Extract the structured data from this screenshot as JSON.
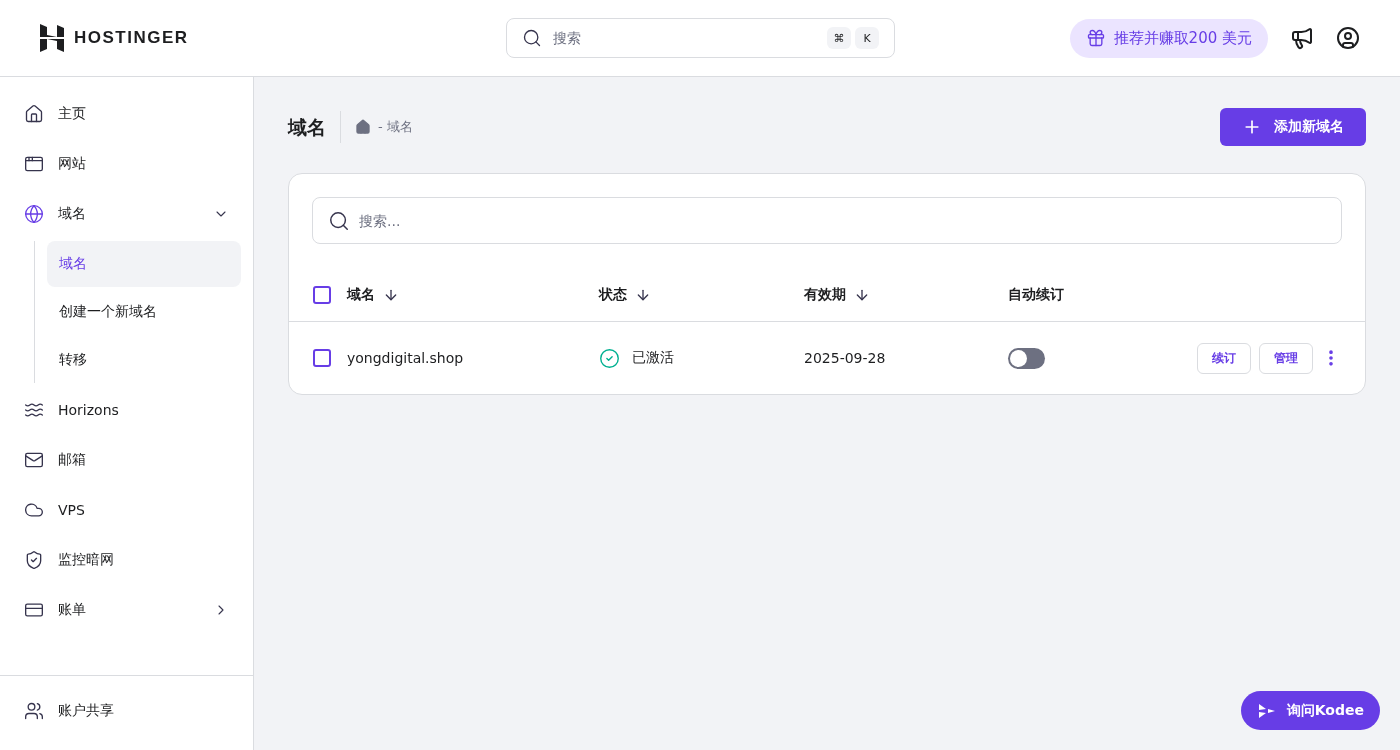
{
  "header": {
    "logo": "HOSTINGER",
    "search": {
      "placeholder": "搜索",
      "keys": [
        "⌘",
        "K"
      ]
    },
    "referral": "推荐并赚取200 美元"
  },
  "sidebar": {
    "items": [
      {
        "label": "主页",
        "selected": false
      },
      {
        "label": "网站",
        "selected": false
      },
      {
        "label": "域名",
        "selected": false,
        "expanded": true,
        "children": [
          {
            "label": "域名",
            "selected": true
          },
          {
            "label": "创建一个新域名",
            "selected": false
          },
          {
            "label": "转移",
            "selected": false
          }
        ]
      },
      {
        "label": "Horizons",
        "selected": false
      },
      {
        "label": "邮箱",
        "selected": false
      },
      {
        "label": "VPS",
        "selected": false
      },
      {
        "label": "监控暗网",
        "selected": false
      },
      {
        "label": "账单",
        "selected": false,
        "expanded": false
      }
    ],
    "footer": {
      "label": "账户共享",
      "selected": false
    }
  },
  "page": {
    "title": "域名",
    "breadcrumb": "- 域名",
    "add_button": "添加新域名"
  },
  "table": {
    "search_placeholder": "搜索...",
    "select_all": {
      "checked": false
    },
    "columns": [
      {
        "label": "域名",
        "sortable": true
      },
      {
        "label": "状态",
        "sortable": true
      },
      {
        "label": "有效期",
        "sortable": true
      },
      {
        "label": "自动续订",
        "sortable": false
      }
    ],
    "rows": [
      {
        "checked": false,
        "domain": "yongdigital.shop",
        "status": "已激活",
        "expiry": "2025-09-28",
        "auto_renew": false,
        "actions": [
          "续订",
          "管理"
        ]
      }
    ]
  },
  "assistant": {
    "label": "询问Kodee"
  }
}
